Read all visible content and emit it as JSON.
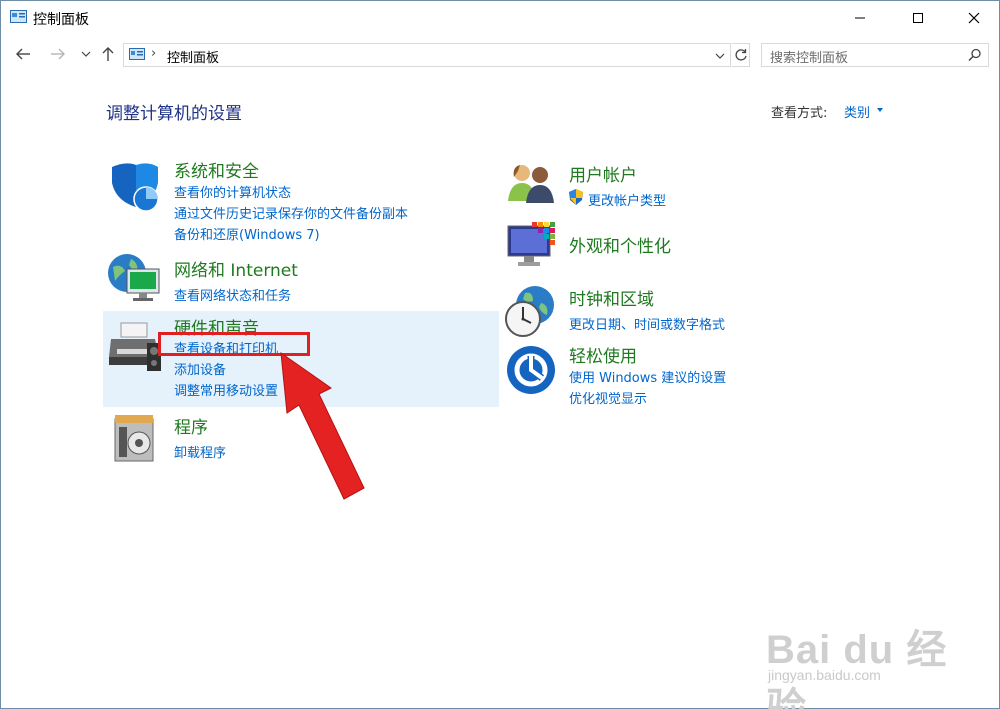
{
  "window": {
    "title": "控制面板"
  },
  "address": {
    "path": "控制面板",
    "separator": "›"
  },
  "search": {
    "placeholder": "搜索控制面板"
  },
  "main": {
    "heading": "调整计算机的设置",
    "view_by_label": "查看方式:",
    "view_by_value": "类别"
  },
  "categories": {
    "system": {
      "title": "系统和安全",
      "links": [
        "查看你的计算机状态",
        "通过文件历史记录保存你的文件备份副本",
        "备份和还原(Windows 7)"
      ]
    },
    "network": {
      "title": "网络和 Internet",
      "links": [
        "查看网络状态和任务"
      ]
    },
    "hardware": {
      "title": "硬件和声音",
      "links": [
        "查看设备和打印机",
        "添加设备",
        "调整常用移动设置"
      ]
    },
    "programs": {
      "title": "程序",
      "links": [
        "卸载程序"
      ]
    },
    "users": {
      "title": "用户帐户",
      "links": [
        "更改帐户类型"
      ]
    },
    "appearance": {
      "title": "外观和个性化",
      "links": []
    },
    "clock": {
      "title": "时钟和区域",
      "links": [
        "更改日期、时间或数字格式"
      ]
    },
    "ease": {
      "title": "轻松使用",
      "links": [
        "使用 Windows 建议的设置",
        "优化视觉显示"
      ]
    }
  },
  "watermark": {
    "main": "Bai du 经验",
    "sub": "jingyan.baidu.com"
  },
  "colors": {
    "link": "#0066cc",
    "category": "#1f7a1f",
    "heading": "#1e3287",
    "highlight": "#e5f1fb",
    "annotation": "#e02020"
  }
}
